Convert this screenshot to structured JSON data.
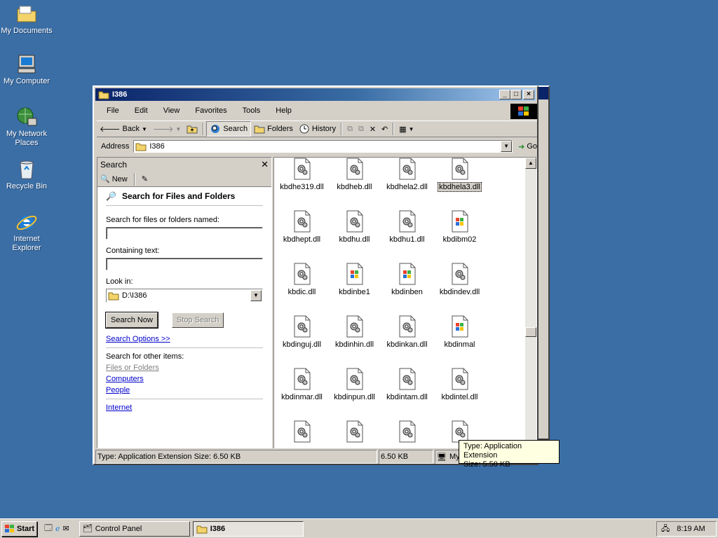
{
  "desktop_icons": [
    {
      "label": "My Documents",
      "icon": "folder-documents-icon"
    },
    {
      "label": "My Computer",
      "icon": "computer-icon"
    },
    {
      "label": "My Network Places",
      "icon": "network-icon"
    },
    {
      "label": "Recycle Bin",
      "icon": "recycle-bin-icon"
    },
    {
      "label": "Internet Explorer",
      "icon": "ie-icon"
    }
  ],
  "window": {
    "title": "I386",
    "menu": [
      "File",
      "Edit",
      "View",
      "Favorites",
      "Tools",
      "Help"
    ],
    "toolbar": {
      "back": "Back",
      "search": "Search",
      "folders": "Folders",
      "history": "History"
    },
    "address": {
      "label": "Address",
      "value": "I386",
      "go": "Go"
    }
  },
  "search_pane": {
    "header": "Search",
    "new_label": "New",
    "title": "Search for Files and Folders",
    "named_label": "Search for files or folders named:",
    "named_value": "",
    "containing_label": "Containing text:",
    "containing_value": "",
    "look_in_label": "Look in:",
    "look_in_value": "D:\\I386",
    "search_now": "Search Now",
    "stop_search": "Stop Search",
    "search_options": "Search Options >>",
    "other_items_label": "Search for other items:",
    "links": [
      "Files or Folders",
      "Computers",
      "People"
    ],
    "internet": "Internet"
  },
  "files": [
    {
      "name": "kbdhe319.dll",
      "type": "dll"
    },
    {
      "name": "kbdheb.dll",
      "type": "dll"
    },
    {
      "name": "kbdhela2.dll",
      "type": "dll"
    },
    {
      "name": "kbdhela3.dll",
      "type": "dll",
      "selected": true
    },
    {
      "name": "kbdhept.dll",
      "type": "dll"
    },
    {
      "name": "kbdhu.dll",
      "type": "dll"
    },
    {
      "name": "kbdhu1.dll",
      "type": "dll"
    },
    {
      "name": "kbdibm02",
      "type": "win"
    },
    {
      "name": "kbdic.dll",
      "type": "dll"
    },
    {
      "name": "kbdinbe1",
      "type": "win"
    },
    {
      "name": "kbdinben",
      "type": "win"
    },
    {
      "name": "kbdindev.dll",
      "type": "dll"
    },
    {
      "name": "kbdinguj.dll",
      "type": "dll"
    },
    {
      "name": "kbdinhin.dll",
      "type": "dll"
    },
    {
      "name": "kbdinkan.dll",
      "type": "dll"
    },
    {
      "name": "kbdinmal",
      "type": "win"
    },
    {
      "name": "kbdinmar.dll",
      "type": "dll"
    },
    {
      "name": "kbdinpun.dll",
      "type": "dll"
    },
    {
      "name": "kbdintam.dll",
      "type": "dll"
    },
    {
      "name": "kbdintel.dll",
      "type": "dll"
    },
    {
      "name": "",
      "type": "dll"
    },
    {
      "name": "",
      "type": "dll"
    },
    {
      "name": "",
      "type": "dll"
    },
    {
      "name": "",
      "type": "dll"
    }
  ],
  "status": {
    "left": "Type: Application Extension Size: 6.50 KB",
    "size": "6.50 KB",
    "zone": "My"
  },
  "tooltip": {
    "line1": "Type: Application Extension",
    "line2": "Size: 5.50 KB"
  },
  "taskbar": {
    "start": "Start",
    "tasks": [
      "Control Panel",
      "I386"
    ],
    "time": "8:19 AM"
  }
}
